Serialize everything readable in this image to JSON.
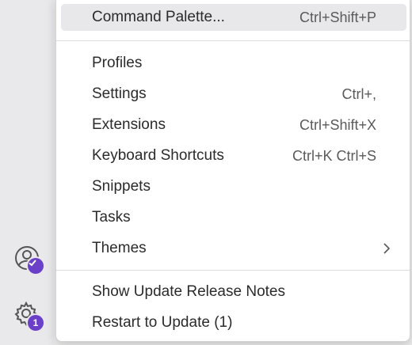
{
  "activity_bar": {
    "accounts_icon": "account-icon",
    "manage_icon": "gear-icon",
    "manage_badge": "1"
  },
  "menu": {
    "items": [
      {
        "label": "Command Palette...",
        "shortcut": "Ctrl+Shift+P"
      },
      {
        "label": "Profiles",
        "shortcut": ""
      },
      {
        "label": "Settings",
        "shortcut": "Ctrl+,"
      },
      {
        "label": "Extensions",
        "shortcut": "Ctrl+Shift+X"
      },
      {
        "label": "Keyboard Shortcuts",
        "shortcut": "Ctrl+K Ctrl+S"
      },
      {
        "label": "Snippets",
        "shortcut": ""
      },
      {
        "label": "Tasks",
        "shortcut": ""
      },
      {
        "label": "Themes",
        "shortcut": ""
      },
      {
        "label": "Show Update Release Notes",
        "shortcut": ""
      },
      {
        "label": "Restart to Update (1)",
        "shortcut": ""
      }
    ]
  },
  "colors": {
    "badge": "#6b3fc8",
    "highlight": "#e8e8ea"
  }
}
